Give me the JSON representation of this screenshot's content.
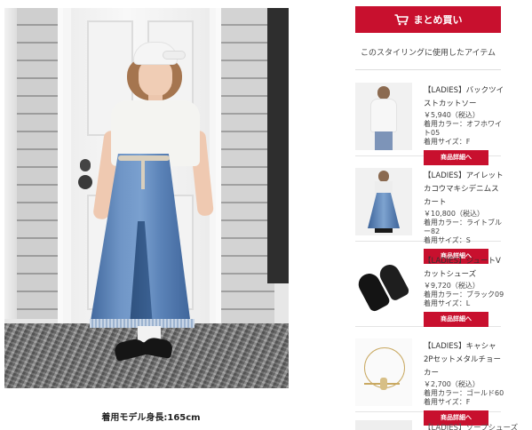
{
  "cart_button": {
    "label": "まとめ買い",
    "icon": "cart-icon"
  },
  "section": {
    "title": "このスタイリングに使用したアイテム"
  },
  "photo": {
    "caption": "着用モデル身長:165cm"
  },
  "items": [
    {
      "name": "【LADIES】バックツイストカットソー",
      "price": "￥5,940（税込）",
      "color": "着用カラー：オフホワイト05",
      "size": "着用サイズ：F",
      "button": "商品詳細へ"
    },
    {
      "name": "【LADIES】アイレットカコウマキシデニムスカート",
      "price": "￥10,800（税込）",
      "color": "着用カラー：ライトブルー82",
      "size": "着用サイズ：S",
      "button": "商品詳細へ"
    },
    {
      "name": "【LADIES】ジュートVカットシューズ",
      "price": "￥9,720（税込）",
      "color": "着用カラー：ブラック09",
      "size": "着用サイズ：L",
      "button": "商品詳細へ"
    },
    {
      "name": "【LADIES】キャシャ2Pセットメタルチョーカー",
      "price": "￥2,700（税込）",
      "color": "着用カラー：ゴールド60",
      "size": "着用サイズ：F",
      "button": "商品詳細へ"
    }
  ],
  "partial_item": {
    "name": "【LADIES】ソープシューズ"
  },
  "colors": {
    "accent": "#c8102e"
  }
}
